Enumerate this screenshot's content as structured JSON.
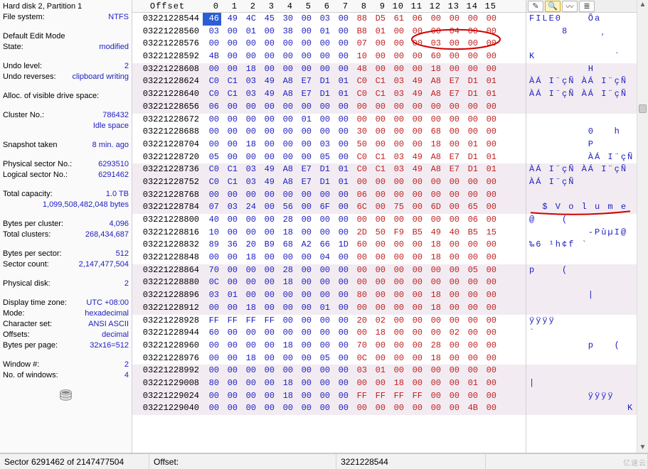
{
  "side": {
    "disk_label": "Hard disk 2, Partition 1",
    "fs_label": "File system:",
    "fs_value": "NTFS",
    "edit_mode_label": "Default Edit Mode",
    "state_label": "State:",
    "state_value": "modified",
    "undo_label": "Undo level:",
    "undo_value": "2",
    "undo_rev_label": "Undo reverses:",
    "undo_rev_value": "clipboard writing",
    "alloc_label": "Alloc. of visible drive space:",
    "cluster_label": "Cluster No.:",
    "cluster_value": "786432",
    "idle_space": "Idle space",
    "snapshot_label": "Snapshot taken",
    "snapshot_value": "8 min. ago",
    "phys_sector_label": "Physical sector No.:",
    "phys_sector_value": "6293510",
    "log_sector_label": "Logical sector No.:",
    "log_sector_value": "6291462",
    "total_cap_label": "Total capacity:",
    "total_cap_value": "1.0 TB",
    "total_cap_bytes": "1,099,508,482,048 bytes",
    "bpc_label": "Bytes per cluster:",
    "bpc_value": "4,096",
    "total_clusters_label": "Total clusters:",
    "total_clusters_value": "268,434,687",
    "bps_label": "Bytes per sector:",
    "bps_value": "512",
    "sector_count_label": "Sector count:",
    "sector_count_value": "2,147,477,504",
    "phys_disk_label": "Physical disk:",
    "phys_disk_value": "2",
    "tz_label": "Display time zone:",
    "tz_value": "UTC +08:00",
    "mode_label": "Mode:",
    "mode_value": "hexadecimal",
    "charset_label": "Character set:",
    "charset_value": "ANSI ASCII",
    "offsets_label": "Offsets:",
    "offsets_value": "decimal",
    "bpp_label": "Bytes per page:",
    "bpp_value": "32x16=512",
    "window_label": "Window #:",
    "window_value": "2",
    "numwin_label": "No. of windows:",
    "numwin_value": "4"
  },
  "header": {
    "offset_label": "Offset",
    "cols": [
      " 0",
      " 1",
      " 2",
      " 3",
      " 4",
      " 5",
      " 6",
      " 7",
      " 8",
      " 9",
      "10",
      "11",
      "12",
      "13",
      "14",
      "15"
    ]
  },
  "status": {
    "sector": "Sector 6291462 of 2147477504",
    "offset_label": "Offset:",
    "offset_value": "3221228544"
  },
  "annotations": {
    "circle_row": 2,
    "circle_cols": [
      11,
      15
    ],
    "underline_row": 17
  },
  "rows": [
    {
      "addr": "03221228544",
      "bytes": [
        "46",
        "49",
        "4C",
        "45",
        "30",
        "00",
        "03",
        "00",
        "88",
        "D5",
        "61",
        "06",
        "00",
        "00",
        "00",
        "00"
      ],
      "ascii": "FILE0    Õa"
    },
    {
      "addr": "03221228560",
      "bytes": [
        "03",
        "00",
        "01",
        "00",
        "38",
        "00",
        "01",
        "00",
        "B8",
        "01",
        "00",
        "00",
        "00",
        "04",
        "00",
        "00"
      ],
      "ascii": "     8     ¸"
    },
    {
      "addr": "03221228576",
      "bytes": [
        "00",
        "00",
        "00",
        "00",
        "00",
        "00",
        "00",
        "00",
        "07",
        "00",
        "00",
        "00",
        "03",
        "00",
        "00",
        "00"
      ],
      "ascii": " "
    },
    {
      "addr": "03221228592",
      "bytes": [
        "4B",
        "00",
        "00",
        "00",
        "00",
        "00",
        "00",
        "00",
        "10",
        "00",
        "00",
        "00",
        "60",
        "00",
        "00",
        "00"
      ],
      "ascii": "K            `"
    },
    {
      "addr": "03221228608",
      "bytes": [
        "00",
        "00",
        "18",
        "00",
        "00",
        "00",
        "00",
        "00",
        "48",
        "00",
        "00",
        "00",
        "18",
        "00",
        "00",
        "00"
      ],
      "ascii": "         H"
    },
    {
      "addr": "03221228624",
      "bytes": [
        "C0",
        "C1",
        "03",
        "49",
        "A8",
        "E7",
        "D1",
        "01",
        "C0",
        "C1",
        "03",
        "49",
        "A8",
        "E7",
        "D1",
        "01"
      ],
      "ascii": "ÀÁ I¨çÑ ÀÁ I¨çÑ"
    },
    {
      "addr": "03221228640",
      "bytes": [
        "C0",
        "C1",
        "03",
        "49",
        "A8",
        "E7",
        "D1",
        "01",
        "C0",
        "C1",
        "03",
        "49",
        "A8",
        "E7",
        "D1",
        "01"
      ],
      "ascii": "ÀÁ I¨çÑ ÀÁ I¨çÑ"
    },
    {
      "addr": "03221228656",
      "bytes": [
        "06",
        "00",
        "00",
        "00",
        "00",
        "00",
        "00",
        "00",
        "00",
        "00",
        "00",
        "00",
        "00",
        "00",
        "00",
        "00"
      ],
      "ascii": " "
    },
    {
      "addr": "03221228672",
      "bytes": [
        "00",
        "00",
        "00",
        "00",
        "00",
        "01",
        "00",
        "00",
        "00",
        "00",
        "00",
        "00",
        "00",
        "00",
        "00",
        "00"
      ],
      "ascii": " "
    },
    {
      "addr": "03221228688",
      "bytes": [
        "00",
        "00",
        "00",
        "00",
        "00",
        "00",
        "00",
        "00",
        "30",
        "00",
        "00",
        "00",
        "68",
        "00",
        "00",
        "00"
      ],
      "ascii": "         0   h"
    },
    {
      "addr": "03221228704",
      "bytes": [
        "00",
        "00",
        "18",
        "00",
        "00",
        "00",
        "03",
        "00",
        "50",
        "00",
        "00",
        "00",
        "18",
        "00",
        "01",
        "00"
      ],
      "ascii": "         P"
    },
    {
      "addr": "03221228720",
      "bytes": [
        "05",
        "00",
        "00",
        "00",
        "00",
        "00",
        "05",
        "00",
        "C0",
        "C1",
        "03",
        "49",
        "A8",
        "E7",
        "D1",
        "01"
      ],
      "ascii": "         ÀÁ I¨çÑ"
    },
    {
      "addr": "03221228736",
      "bytes": [
        "C0",
        "C1",
        "03",
        "49",
        "A8",
        "E7",
        "D1",
        "01",
        "C0",
        "C1",
        "03",
        "49",
        "A8",
        "E7",
        "D1",
        "01"
      ],
      "ascii": "ÀÁ I¨çÑ ÀÁ I¨çÑ"
    },
    {
      "addr": "03221228752",
      "bytes": [
        "C0",
        "C1",
        "03",
        "49",
        "A8",
        "E7",
        "D1",
        "01",
        "00",
        "00",
        "00",
        "00",
        "00",
        "00",
        "00",
        "00"
      ],
      "ascii": "ÀÁ I¨çÑ"
    },
    {
      "addr": "03221228768",
      "bytes": [
        "00",
        "00",
        "00",
        "00",
        "00",
        "00",
        "00",
        "00",
        "06",
        "00",
        "00",
        "00",
        "00",
        "00",
        "00",
        "00"
      ],
      "ascii": " "
    },
    {
      "addr": "03221228784",
      "bytes": [
        "07",
        "03",
        "24",
        "00",
        "56",
        "00",
        "6F",
        "00",
        "6C",
        "00",
        "75",
        "00",
        "6D",
        "00",
        "65",
        "00"
      ],
      "ascii": "  $ V o l u m e"
    },
    {
      "addr": "03221228800",
      "bytes": [
        "40",
        "00",
        "00",
        "00",
        "28",
        "00",
        "00",
        "00",
        "00",
        "00",
        "00",
        "00",
        "00",
        "00",
        "06",
        "00"
      ],
      "ascii": "@    ("
    },
    {
      "addr": "03221228816",
      "bytes": [
        "10",
        "00",
        "00",
        "00",
        "18",
        "00",
        "00",
        "00",
        "2D",
        "50",
        "F9",
        "B5",
        "49",
        "40",
        "B5",
        "15"
      ],
      "ascii": "         -PùµI@"
    },
    {
      "addr": "03221228832",
      "bytes": [
        "89",
        "36",
        "20",
        "B9",
        "68",
        "A2",
        "66",
        "1D",
        "60",
        "00",
        "00",
        "00",
        "18",
        "00",
        "00",
        "00"
      ],
      "ascii": "‰6 ¹h¢f `"
    },
    {
      "addr": "03221228848",
      "bytes": [
        "00",
        "00",
        "18",
        "00",
        "00",
        "00",
        "04",
        "00",
        "00",
        "00",
        "00",
        "00",
        "18",
        "00",
        "00",
        "00"
      ],
      "ascii": " "
    },
    {
      "addr": "03221228864",
      "bytes": [
        "70",
        "00",
        "00",
        "00",
        "28",
        "00",
        "00",
        "00",
        "00",
        "00",
        "00",
        "00",
        "00",
        "00",
        "05",
        "00"
      ],
      "ascii": "p    ("
    },
    {
      "addr": "03221228880",
      "bytes": [
        "0C",
        "00",
        "00",
        "00",
        "18",
        "00",
        "00",
        "00",
        "00",
        "00",
        "00",
        "00",
        "00",
        "00",
        "00",
        "00"
      ],
      "ascii": " "
    },
    {
      "addr": "03221228896",
      "bytes": [
        "03",
        "01",
        "00",
        "00",
        "00",
        "00",
        "00",
        "00",
        "80",
        "00",
        "00",
        "00",
        "18",
        "00",
        "00",
        "00"
      ],
      "ascii": "         |"
    },
    {
      "addr": "03221228912",
      "bytes": [
        "00",
        "00",
        "18",
        "00",
        "00",
        "00",
        "01",
        "00",
        "00",
        "00",
        "00",
        "00",
        "18",
        "00",
        "00",
        "00"
      ],
      "ascii": " "
    },
    {
      "addr": "03221228928",
      "bytes": [
        "FF",
        "FF",
        "FF",
        "FF",
        "00",
        "00",
        "00",
        "00",
        "20",
        "02",
        "00",
        "00",
        "00",
        "00",
        "00",
        "00"
      ],
      "ascii": "ÿÿÿÿ"
    },
    {
      "addr": "03221228944",
      "bytes": [
        "60",
        "00",
        "00",
        "00",
        "00",
        "00",
        "00",
        "00",
        "00",
        "18",
        "00",
        "00",
        "00",
        "02",
        "00",
        "00"
      ],
      "ascii": "`"
    },
    {
      "addr": "03221228960",
      "bytes": [
        "00",
        "00",
        "00",
        "00",
        "18",
        "00",
        "00",
        "00",
        "70",
        "00",
        "00",
        "00",
        "28",
        "00",
        "00",
        "00"
      ],
      "ascii": "         p   ("
    },
    {
      "addr": "03221228976",
      "bytes": [
        "00",
        "00",
        "18",
        "00",
        "00",
        "00",
        "05",
        "00",
        "0C",
        "00",
        "00",
        "00",
        "18",
        "00",
        "00",
        "00"
      ],
      "ascii": " "
    },
    {
      "addr": "03221228992",
      "bytes": [
        "00",
        "00",
        "00",
        "00",
        "00",
        "00",
        "00",
        "00",
        "03",
        "01",
        "00",
        "00",
        "00",
        "00",
        "00",
        "00"
      ],
      "ascii": " "
    },
    {
      "addr": "03221229008",
      "bytes": [
        "80",
        "00",
        "00",
        "00",
        "18",
        "00",
        "00",
        "00",
        "00",
        "00",
        "18",
        "00",
        "00",
        "00",
        "01",
        "00"
      ],
      "ascii": "|"
    },
    {
      "addr": "03221229024",
      "bytes": [
        "00",
        "00",
        "00",
        "00",
        "18",
        "00",
        "00",
        "00",
        "FF",
        "FF",
        "FF",
        "FF",
        "00",
        "00",
        "00",
        "00"
      ],
      "ascii": "         ÿÿÿÿ"
    },
    {
      "addr": "03221229040",
      "bytes": [
        "00",
        "00",
        "00",
        "00",
        "00",
        "00",
        "00",
        "00",
        "00",
        "00",
        "00",
        "00",
        "00",
        "00",
        "4B",
        "00"
      ],
      "ascii": "               K"
    }
  ]
}
